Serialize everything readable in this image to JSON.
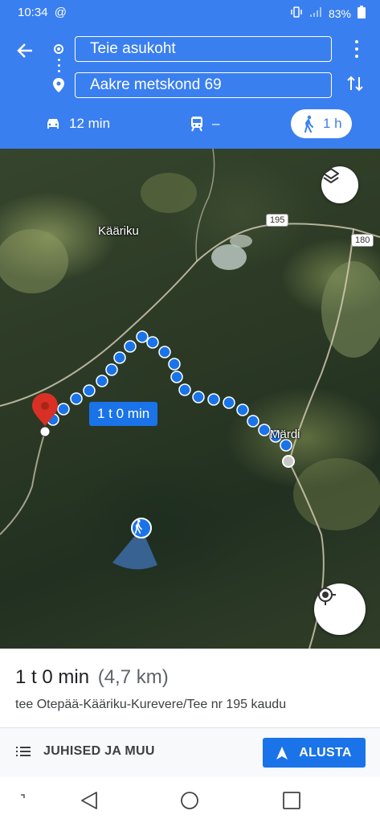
{
  "status_bar": {
    "time": "10:34",
    "notification_icon": "at-icon",
    "battery": "83%"
  },
  "directions": {
    "origin_value": "Teie asukoht",
    "destination_value": "Aakre metskond 69",
    "modes": [
      {
        "icon": "car-icon",
        "label": "12 min"
      },
      {
        "icon": "train-icon",
        "label": "–"
      },
      {
        "icon": "walk-icon",
        "label": "1 h",
        "selected": true
      }
    ]
  },
  "map": {
    "labels": {
      "village1": "Kääriku",
      "village2": "Märdi"
    },
    "road_badges": [
      "195",
      "180"
    ],
    "route_duration": "1 t 0 min"
  },
  "summary": {
    "duration": "1 t 0 min",
    "distance": "(4,7 km)",
    "via": "tee Otepää-Kääriku-Kurevere/Tee nr 195 kaudu"
  },
  "actions": {
    "steps_label": "JUHISED JA MUU",
    "start_label": "ALUSTA"
  },
  "colors": {
    "primary": "#3a7ff0",
    "route": "#1a73e8",
    "destination_pin": "#d93025"
  }
}
